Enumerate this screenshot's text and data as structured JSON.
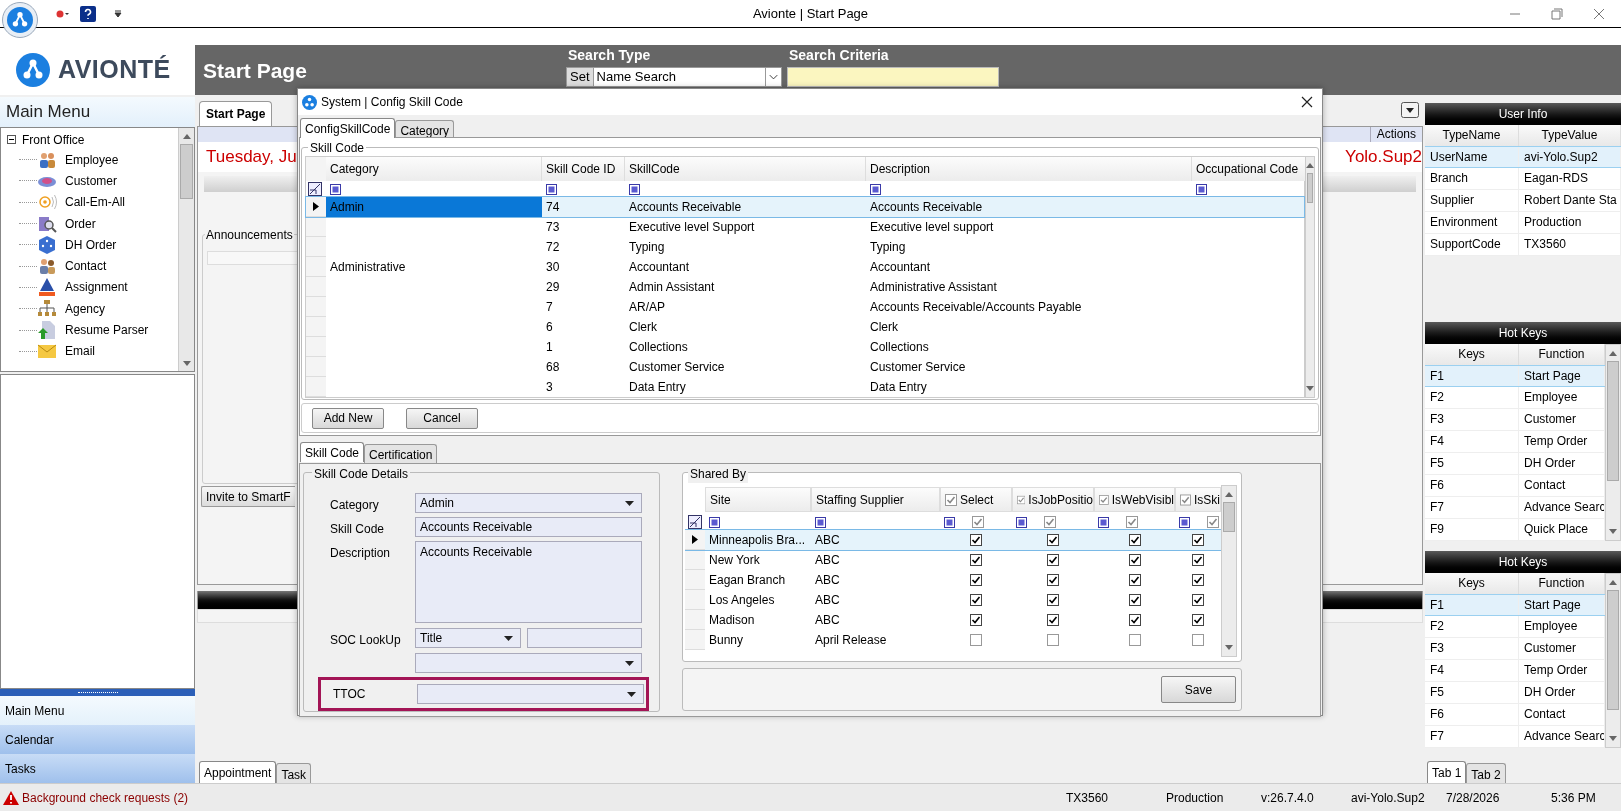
{
  "window": {
    "title": "Avionte | Start Page"
  },
  "logo": {
    "text": "AVIONTÉ"
  },
  "header": {
    "page_title": "Start Page",
    "search_type_label": "Search Type",
    "search_type_button": "Set",
    "search_type_value": "Name Search",
    "search_criteria_label": "Search Criteria"
  },
  "main_menu": {
    "title": "Main Menu",
    "tree": [
      {
        "label": "Front Office",
        "expanded": true,
        "children": [
          {
            "label": "Employee"
          },
          {
            "label": "Customer"
          },
          {
            "label": "Call-Em-All"
          },
          {
            "label": "Order"
          },
          {
            "label": "DH Order"
          },
          {
            "label": "Contact"
          },
          {
            "label": "Assignment"
          },
          {
            "label": "Agency"
          },
          {
            "label": "Resume Parser"
          },
          {
            "label": "Email"
          }
        ]
      }
    ]
  },
  "nav_buttons": [
    {
      "label": "Main Menu",
      "selected": true
    },
    {
      "label": "Calendar",
      "selected": false
    },
    {
      "label": "Tasks",
      "selected": false
    }
  ],
  "start_page": {
    "tabs": [
      {
        "label": "Start Page",
        "selected": true
      }
    ],
    "actions": "Actions",
    "date_fragment": "Tuesday, Ju",
    "user_fragment": "Yolo.Sup2",
    "announcements": "Announcements",
    "invite_button": "Invite to SmartF",
    "bottom_tabs": [
      {
        "label": "Appointment",
        "selected": true
      },
      {
        "label": "Task",
        "selected": false
      }
    ]
  },
  "dialog": {
    "title": "System | Config Skill Code",
    "tabs": [
      {
        "label": "ConfigSkillCode",
        "selected": true
      },
      {
        "label": "Category",
        "selected": false
      }
    ],
    "group_title": "Skill Code",
    "columns": [
      "Category",
      "Skill Code ID",
      "SkillCode",
      "Description",
      "Occupational Code"
    ],
    "rows": [
      {
        "category": "Admin",
        "id": "74",
        "skill_code": "Accounts Receivable",
        "description": "Accounts Receivable",
        "selected": true
      },
      {
        "id": "73",
        "skill_code": "Executive level Support",
        "description": "Executive level support",
        "selected": false
      },
      {
        "id": "72",
        "skill_code": "Typing",
        "description": "Typing",
        "selected": false
      },
      {
        "category": "Administrative",
        "id": "30",
        "skill_code": "Accountant",
        "description": "Accountant",
        "selected": false
      },
      {
        "id": "29",
        "skill_code": "Admin Assistant",
        "description": "Administrative Assistant",
        "selected": false
      },
      {
        "id": "7",
        "skill_code": "AR/AP",
        "description": "Accounts Receivable/Accounts Payable",
        "selected": false
      },
      {
        "id": "6",
        "skill_code": "Clerk",
        "description": "Clerk",
        "selected": false
      },
      {
        "id": "1",
        "skill_code": "Collections",
        "description": "Collections",
        "selected": false
      },
      {
        "id": "68",
        "skill_code": "Customer Service",
        "description": "Customer Service",
        "selected": false
      },
      {
        "id": "3",
        "skill_code": "Data Entry",
        "description": "Data Entry",
        "selected": false
      }
    ],
    "buttons": [
      "Add New",
      "Cancel"
    ],
    "detail_tabs": [
      {
        "label": "Skill Code",
        "selected": true
      },
      {
        "label": "Certification",
        "selected": false
      }
    ],
    "details": {
      "title": "Skill Code Details",
      "fields": [
        {
          "label": "Category",
          "kind": "dropdown",
          "value": "Admin"
        },
        {
          "label": "Skill Code",
          "kind": "text",
          "value": "Accounts Receivable"
        },
        {
          "label": "Description",
          "kind": "textarea",
          "value": "Accounts Receivable"
        },
        {
          "label": "SOC LookUp",
          "kind": "soc",
          "value": "Title"
        },
        {
          "label": "TTOC",
          "kind": "dropdown",
          "highlighted": true
        }
      ]
    },
    "shared_by": {
      "title": "Shared By",
      "columns": [
        {
          "label": "Site",
          "kind": "text"
        },
        {
          "label": "Staffing Supplier",
          "kind": "text"
        },
        {
          "label": "Select",
          "kind": "check",
          "checked": true
        },
        {
          "label": "IsJobPositio",
          "kind": "check",
          "checked": true
        },
        {
          "label": "IsWebVisibl",
          "kind": "check",
          "checked": true
        },
        {
          "label": "IsSki",
          "kind": "check",
          "checked": true
        }
      ],
      "rows": [
        {
          "site": "Minneapolis Bra...",
          "supplier": "ABC",
          "checks": [
            true,
            true,
            true,
            true
          ],
          "selected": true
        },
        {
          "site": "New York",
          "supplier": "ABC",
          "checks": [
            true,
            true,
            true,
            true
          ],
          "selected": false
        },
        {
          "site": "Eagan Branch",
          "supplier": "ABC",
          "checks": [
            true,
            true,
            true,
            true
          ],
          "selected": false
        },
        {
          "site": "Los Angeles",
          "supplier": "ABC",
          "checks": [
            true,
            true,
            true,
            true
          ],
          "selected": false
        },
        {
          "site": "Madison",
          "supplier": "ABC",
          "checks": [
            true,
            true,
            true,
            true
          ],
          "selected": false
        },
        {
          "site": "Bunny",
          "supplier": "April Release",
          "checks": [
            false,
            false,
            false,
            false
          ],
          "selected": false
        }
      ]
    },
    "save_button": "Save"
  },
  "user_info": {
    "title": "User Info",
    "columns": [
      "TypeName",
      "TypeValue"
    ],
    "rows": [
      {
        "cells": [
          "UserName",
          "avi-Yolo.Sup2"
        ],
        "selected": true
      },
      {
        "cells": [
          "Branch",
          "Eagan-RDS"
        ],
        "selected": false
      },
      {
        "cells": [
          "Supplier",
          "Robert Dante Sta"
        ],
        "selected": false
      },
      {
        "cells": [
          "Environment",
          "Production"
        ],
        "selected": false
      },
      {
        "cells": [
          "SupportCode",
          "TX3560"
        ],
        "selected": false
      }
    ]
  },
  "hot_keys": [
    {
      "title": "Hot Keys",
      "columns": [
        "Keys",
        "Function"
      ],
      "rows": [
        {
          "cells": [
            "F1",
            "Start Page"
          ],
          "selected": true
        },
        {
          "cells": [
            "F2",
            "Employee"
          ],
          "selected": false
        },
        {
          "cells": [
            "F3",
            "Customer"
          ],
          "selected": false
        },
        {
          "cells": [
            "F4",
            "Temp Order"
          ],
          "selected": false
        },
        {
          "cells": [
            "F5",
            "DH Order"
          ],
          "selected": false
        },
        {
          "cells": [
            "F6",
            "Contact"
          ],
          "selected": false
        },
        {
          "cells": [
            "F7",
            "Advance Searc"
          ],
          "selected": false
        },
        {
          "cells": [
            "F9",
            "Quick Place"
          ],
          "selected": false
        }
      ]
    },
    {
      "title": "Hot Keys",
      "columns": [
        "Keys",
        "Function"
      ],
      "rows": [
        {
          "cells": [
            "F1",
            "Start Page"
          ],
          "selected": true
        },
        {
          "cells": [
            "F2",
            "Employee"
          ],
          "selected": false
        },
        {
          "cells": [
            "F3",
            "Customer"
          ],
          "selected": false
        },
        {
          "cells": [
            "F4",
            "Temp Order"
          ],
          "selected": false
        },
        {
          "cells": [
            "F5",
            "DH Order"
          ],
          "selected": false
        },
        {
          "cells": [
            "F6",
            "Contact"
          ],
          "selected": false
        },
        {
          "cells": [
            "F7",
            "Advance Searc"
          ],
          "selected": false
        }
      ]
    }
  ],
  "right_tabs": [
    {
      "label": "Tab 1",
      "selected": true
    },
    {
      "label": "Tab 2",
      "selected": false
    }
  ],
  "status_bar": {
    "alert": "Background check requests (2)",
    "items": [
      "TX3560",
      "Production",
      "v:26.7.4.0",
      "avi-Yolo.Sup2",
      "7/28/2026",
      "5:36 PM"
    ]
  }
}
